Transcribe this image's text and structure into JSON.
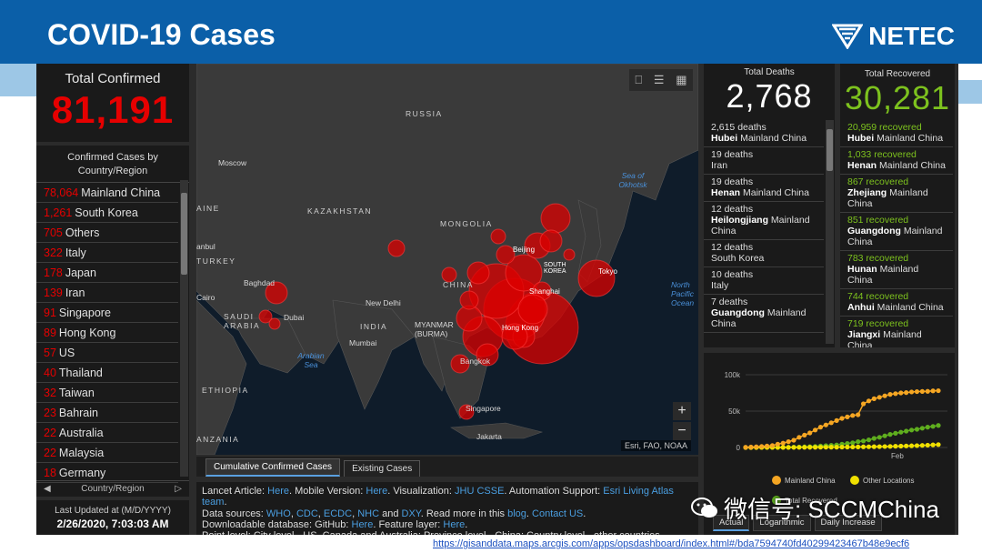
{
  "slide": {
    "title": "COVID-19 Cases",
    "brand": "NETEC",
    "url": "https://gisanddata.maps.arcgis.com/apps/opsdashboard/index.html#/bda7594740fd40299423467b48e9ecf6",
    "watermark": "微信号: SCCMChina"
  },
  "total_confirmed": {
    "label": "Total Confirmed",
    "value": "81,191"
  },
  "countries": {
    "header": "Confirmed Cases by Country/Region",
    "footer": "Country/Region",
    "items": [
      {
        "value": "78,064",
        "name": "Mainland China"
      },
      {
        "value": "1,261",
        "name": "South Korea"
      },
      {
        "value": "705",
        "name": "Others"
      },
      {
        "value": "322",
        "name": "Italy"
      },
      {
        "value": "178",
        "name": "Japan"
      },
      {
        "value": "139",
        "name": "Iran"
      },
      {
        "value": "91",
        "name": "Singapore"
      },
      {
        "value": "89",
        "name": "Hong Kong"
      },
      {
        "value": "57",
        "name": "US"
      },
      {
        "value": "40",
        "name": "Thailand"
      },
      {
        "value": "32",
        "name": "Taiwan"
      },
      {
        "value": "23",
        "name": "Bahrain"
      },
      {
        "value": "22",
        "name": "Australia"
      },
      {
        "value": "22",
        "name": "Malaysia"
      },
      {
        "value": "18",
        "name": "Germany"
      }
    ]
  },
  "updated": {
    "label": "Last Updated at (M/D/YYYY)",
    "value": "2/26/2020, 7:03:03 AM"
  },
  "map": {
    "labels": {
      "russia": "RUSSIA",
      "kazakhstan": "KAZAKHSTAN",
      "mongolia": "MONGOLIA",
      "china": "CHINA",
      "india": "INDIA",
      "moscow": "Moscow",
      "newdelhi": "New Delhi",
      "mumbai": "Mumbai",
      "baghdad": "Baghdad",
      "dubai": "Dubai",
      "cairo": "Cairo",
      "saudi": "SAUDI ARABIA",
      "turkey": "TURKEY",
      "ukraine": "AINE",
      "istanbul": "anbul",
      "ethiopia": "ETHIOPIA",
      "tanzania": "ANZANIA",
      "myanmar": "MYANMAR (BURMA)",
      "beijing": "Beijing",
      "shanghai": "Shanghai",
      "tokyo": "Tokyo",
      "southkorea": "SOUTH KOREA",
      "hongkong": "Hong Kong",
      "bangkok": "Bangkok",
      "singapore": "Singapore",
      "jakarta": "Jakarta",
      "okhotsk": "Sea of Okhotsk",
      "arabian": "Arabian Sea",
      "pacific": "North Pacific Ocean"
    },
    "attribution": "Esri, FAO, NOAA",
    "zoom_in": "+",
    "zoom_out": "−"
  },
  "map_tabs": [
    "Cumulative Confirmed Cases",
    "Existing Cases"
  ],
  "info": {
    "lines": [
      [
        {
          "t": "Lancet Article: "
        },
        {
          "t": "Here",
          "l": true
        },
        {
          "t": ". Mobile Version: "
        },
        {
          "t": "Here",
          "l": true
        },
        {
          "t": ". Visualization: "
        },
        {
          "t": "JHU CSSE",
          "l": true
        },
        {
          "t": ". Automation Support: "
        },
        {
          "t": "Esri Living Atlas team",
          "l": true
        },
        {
          "t": "."
        }
      ],
      [
        {
          "t": "Data sources: "
        },
        {
          "t": "WHO",
          "l": true
        },
        {
          "t": ", "
        },
        {
          "t": "CDC",
          "l": true
        },
        {
          "t": ", "
        },
        {
          "t": "ECDC",
          "l": true
        },
        {
          "t": ", "
        },
        {
          "t": "NHC",
          "l": true
        },
        {
          "t": " and "
        },
        {
          "t": "DXY",
          "l": true
        },
        {
          "t": ". Read more in this "
        },
        {
          "t": "blog",
          "l": true
        },
        {
          "t": ". "
        },
        {
          "t": "Contact US",
          "l": true
        },
        {
          "t": "."
        }
      ],
      [
        {
          "t": "Downloadable database: GitHub: "
        },
        {
          "t": "Here",
          "l": true
        },
        {
          "t": ". Feature layer: "
        },
        {
          "t": "Here",
          "l": true
        },
        {
          "t": "."
        }
      ],
      [
        {
          "t": "Point level: City level - US, Canada and Australia; Province level - China; Country level - other countries."
        }
      ]
    ]
  },
  "deaths": {
    "label": "Total Deaths",
    "value": "2,768",
    "items": [
      {
        "count": "2,615 deaths",
        "place": "Hubei",
        "region": "Mainland China"
      },
      {
        "count": "19 deaths",
        "place": "",
        "region": "Iran"
      },
      {
        "count": "19 deaths",
        "place": "Henan",
        "region": "Mainland China"
      },
      {
        "count": "12 deaths",
        "place": "Heilongjiang",
        "region": "Mainland China"
      },
      {
        "count": "12 deaths",
        "place": "",
        "region": "South Korea"
      },
      {
        "count": "10 deaths",
        "place": "",
        "region": "Italy"
      },
      {
        "count": "7 deaths",
        "place": "Guangdong",
        "region": "Mainland China"
      }
    ]
  },
  "recovered": {
    "label": "Total Recovered",
    "value": "30,281",
    "items": [
      {
        "count": "20,959 recovered",
        "place": "Hubei",
        "region": "Mainland China"
      },
      {
        "count": "1,033 recovered",
        "place": "Henan",
        "region": "Mainland China"
      },
      {
        "count": "867 recovered",
        "place": "Zhejiang",
        "region": "Mainland China"
      },
      {
        "count": "851 recovered",
        "place": "Guangdong",
        "region": "Mainland China"
      },
      {
        "count": "783 recovered",
        "place": "Hunan",
        "region": "Mainland China"
      },
      {
        "count": "744 recovered",
        "place": "Anhui",
        "region": "Mainland China"
      },
      {
        "count": "719 recovered",
        "place": "Jiangxi",
        "region": "Mainland China"
      }
    ]
  },
  "chart_data": {
    "type": "line",
    "yticks": [
      "100k",
      "50k",
      "0"
    ],
    "ylim": [
      0,
      100000
    ],
    "xlabel": "Feb",
    "series": [
      {
        "name": "Mainland China",
        "color": "#f5a623",
        "values": [
          300,
          600,
          1000,
          1500,
          2000,
          2700,
          4500,
          6000,
          8000,
          10000,
          14000,
          17000,
          20000,
          24000,
          28000,
          31000,
          34000,
          37000,
          40000,
          42000,
          44000,
          45000,
          60000,
          64000,
          67000,
          69000,
          71000,
          73000,
          74000,
          75000,
          75500,
          76300,
          76800,
          77000,
          77200,
          77800,
          78064
        ]
      },
      {
        "name": "Other Locations",
        "color": "#f0e000",
        "values": [
          10,
          20,
          30,
          50,
          80,
          100,
          120,
          150,
          170,
          200,
          250,
          280,
          300,
          330,
          360,
          400,
          450,
          500,
          550,
          600,
          700,
          800,
          900,
          1000,
          1100,
          1200,
          1300,
          1500,
          1700,
          1900,
          2100,
          2300,
          2600,
          2900,
          3200,
          3600,
          4000
        ]
      },
      {
        "name": "Total Recovered",
        "color": "#5fae1e",
        "values": [
          20,
          30,
          40,
          50,
          60,
          100,
          130,
          200,
          300,
          500,
          700,
          900,
          1200,
          1500,
          2000,
          2500,
          3000,
          3500,
          4500,
          5500,
          6500,
          8000,
          9000,
          10500,
          12500,
          14000,
          16000,
          18000,
          19500,
          21000,
          22500,
          24000,
          25000,
          26500,
          28000,
          29000,
          30281
        ]
      }
    ],
    "legend": [
      "Mainland China",
      "Other Locations",
      "Total Recovered"
    ],
    "tabs": [
      "Actual",
      "Logarithmic",
      "Daily Increase"
    ]
  },
  "colors": {
    "confirmed": "#e60000",
    "recovered": "#7dc21e",
    "banner": "#0b5fa8"
  }
}
